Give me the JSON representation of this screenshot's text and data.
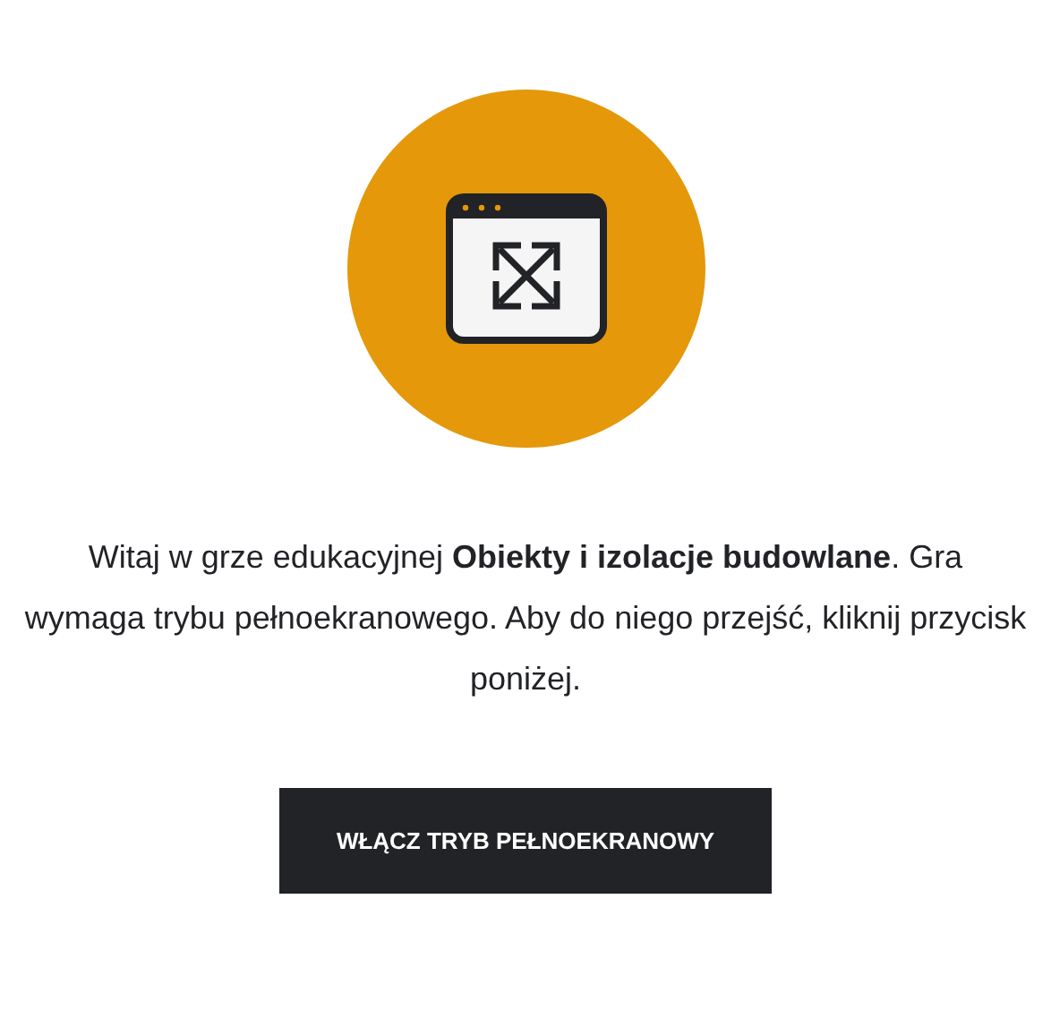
{
  "intro": "Witaj w grze edukacyjnej **Obiekty i izolacje budowlane**. Gra wymaga trybu pełnoekranowego. Aby do niego przejść, kliknij przycisk poniżej.",
  "button": "WŁĄCZ TRYB PEŁNOEKRANOWY"
}
